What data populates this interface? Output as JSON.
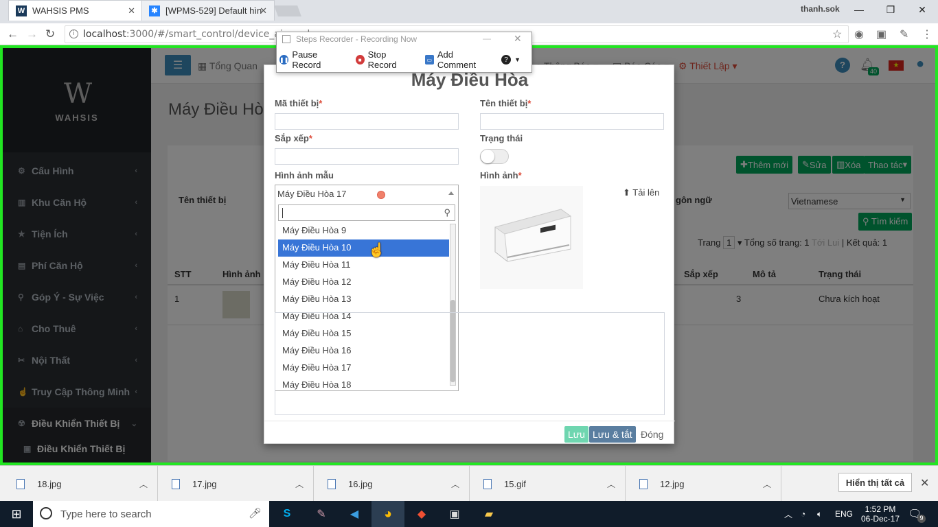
{
  "browser": {
    "tabs": [
      {
        "title": "WAHSIS PMS",
        "favicon": "W"
      },
      {
        "title": "[WPMS-529] Default hìn",
        "favicon": "jira"
      }
    ],
    "user": "thanh.sok",
    "url_prefix": "localhost",
    "url_rest": ":3000/#/smart_control/device_aircond"
  },
  "recorder": {
    "title": "Steps Recorder - Recording Now",
    "pause": "Pause Record",
    "stop": "Stop Record",
    "comment": "Add Comment"
  },
  "sidebar": {
    "logo": "WAHSIS",
    "items": [
      {
        "label": "Cấu Hình",
        "icon": "gear-icon"
      },
      {
        "label": "Khu Căn Hộ",
        "icon": "building-icon"
      },
      {
        "label": "Tiện Ích",
        "icon": "star-icon"
      },
      {
        "label": "Phí Căn Hộ",
        "icon": "document-icon"
      },
      {
        "label": "Góp Ý - Sự Việc",
        "icon": "pin-icon"
      },
      {
        "label": "Cho Thuê",
        "icon": "home-icon"
      },
      {
        "label": "Nội Thất",
        "icon": "tools-icon"
      },
      {
        "label": "Truy Cập Thông Minh",
        "icon": "hand-icon"
      },
      {
        "label": "Điều Khiển Thiết Bị",
        "icon": "control-icon"
      }
    ],
    "sub_item": "Điều Khiển Thiết Bị"
  },
  "topnav": {
    "home": "Tổng Quan",
    "notify": "Thông Báo",
    "report": "Báo Cáo",
    "setup": "Thiết Lập",
    "badge": "40"
  },
  "page": {
    "title": "Máy Điều Hò",
    "filter_label": "Tên thiết bị",
    "lang_label": "gôn ngữ",
    "lang_value": "Vietnamese",
    "search_btn": "Tìm kiếm",
    "add_btn": "Thêm mới",
    "edit_btn": "Sửa",
    "del_btn": "Xóa",
    "action_btn": "Thao tác",
    "paging": {
      "page_label": "Trang",
      "page": "1",
      "total_label": "Tổng số trang: 1",
      "result": "Kết quả: 1"
    },
    "table": {
      "headers": [
        "STT",
        "Hình ảnh",
        "Sắp xếp",
        "Mô tả",
        "Trạng thái"
      ],
      "row": {
        "stt": "1",
        "order": "3",
        "status": "Chưa kích hoạt"
      }
    }
  },
  "modal": {
    "title": "Máy Điều Hòa",
    "code_label": "Mã thiết bị",
    "name_label": "Tên thiết bị",
    "order_label": "Sắp xếp",
    "status_label": "Trạng thái",
    "sample_label": "Hình ảnh mẫu",
    "image_label": "Hình ảnh",
    "upload": "Tải lên",
    "selected": "Máy Điều Hòa 17",
    "options": [
      "Máy Điều Hòa 9",
      "Máy Điều Hòa 10",
      "Máy Điều Hòa 11",
      "Máy Điều Hòa 12",
      "Máy Điều Hòa 13",
      "Máy Điều Hòa 14",
      "Máy Điều Hòa 15",
      "Máy Điều Hòa 16",
      "Máy Điều Hòa 17",
      "Máy Điều Hòa 18"
    ],
    "highlighted": "Máy Điều Hòa 10",
    "save": "Lưu",
    "save_close": "Lưu & tắt",
    "close": "Đóng"
  },
  "downloads": [
    "18.jpg",
    "17.jpg",
    "16.jpg",
    "15.gif",
    "12.jpg"
  ],
  "show_all": "Hiển thị tất cả",
  "taskbar": {
    "search": "Type here to search",
    "lang": "ENG",
    "time": "1:52 PM",
    "date": "06-Dec-17",
    "notif": "9"
  }
}
